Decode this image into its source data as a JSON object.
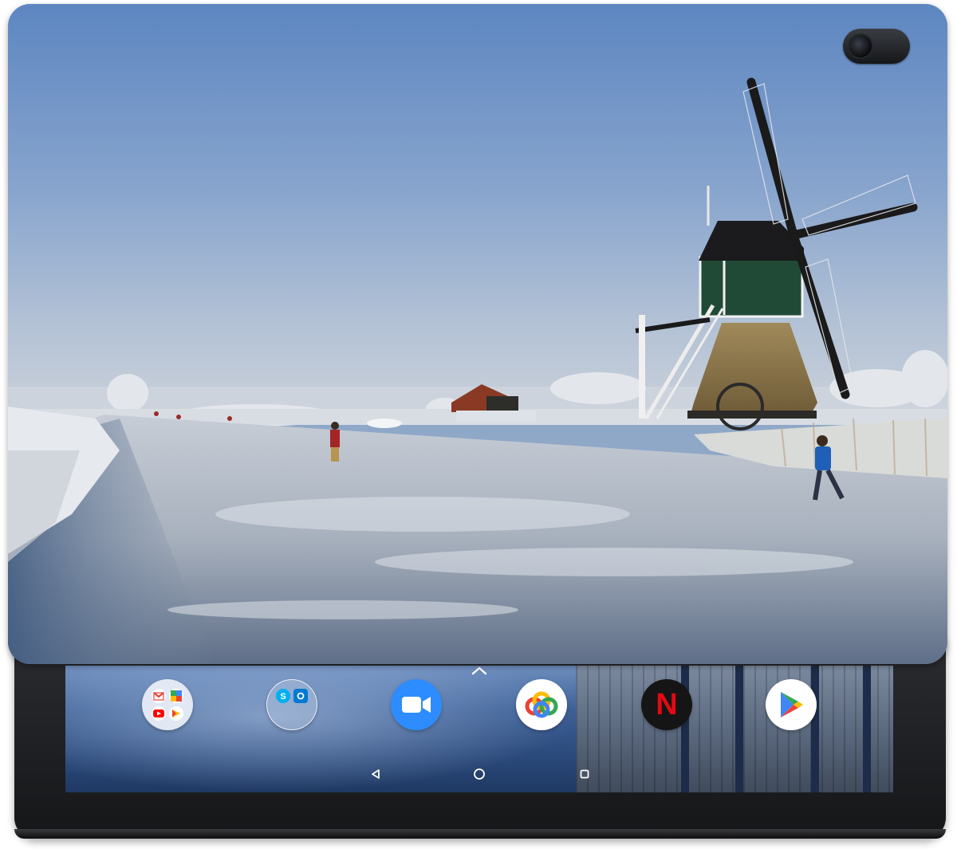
{
  "device": {
    "type": "tablet",
    "case": "smart-cover-photo-print"
  },
  "cover": {
    "image_subject": "windmill",
    "camera": "rear-camera"
  },
  "dock": {
    "chevron_icon": "chevron-up-icon",
    "apps": [
      {
        "icon": "google-apps-folder-icon"
      },
      {
        "icon": "skype-outlook-folder-icon"
      },
      {
        "icon": "zoom-icon"
      },
      {
        "icon": "photos-cloud-icon"
      },
      {
        "icon": "netflix-icon",
        "glyph": "N"
      },
      {
        "icon": "play-store-icon"
      }
    ]
  },
  "navbar": {
    "back_icon": "back-icon",
    "home_icon": "home-icon",
    "recents_icon": "recents-icon"
  },
  "colors": {
    "zoom_blue": "#2d8cff",
    "netflix_red": "#e50914",
    "gmail_red": "#ea4335",
    "youtube_red": "#ff0000",
    "skype_blue": "#00aff0",
    "outlook_blue": "#0078d4"
  }
}
